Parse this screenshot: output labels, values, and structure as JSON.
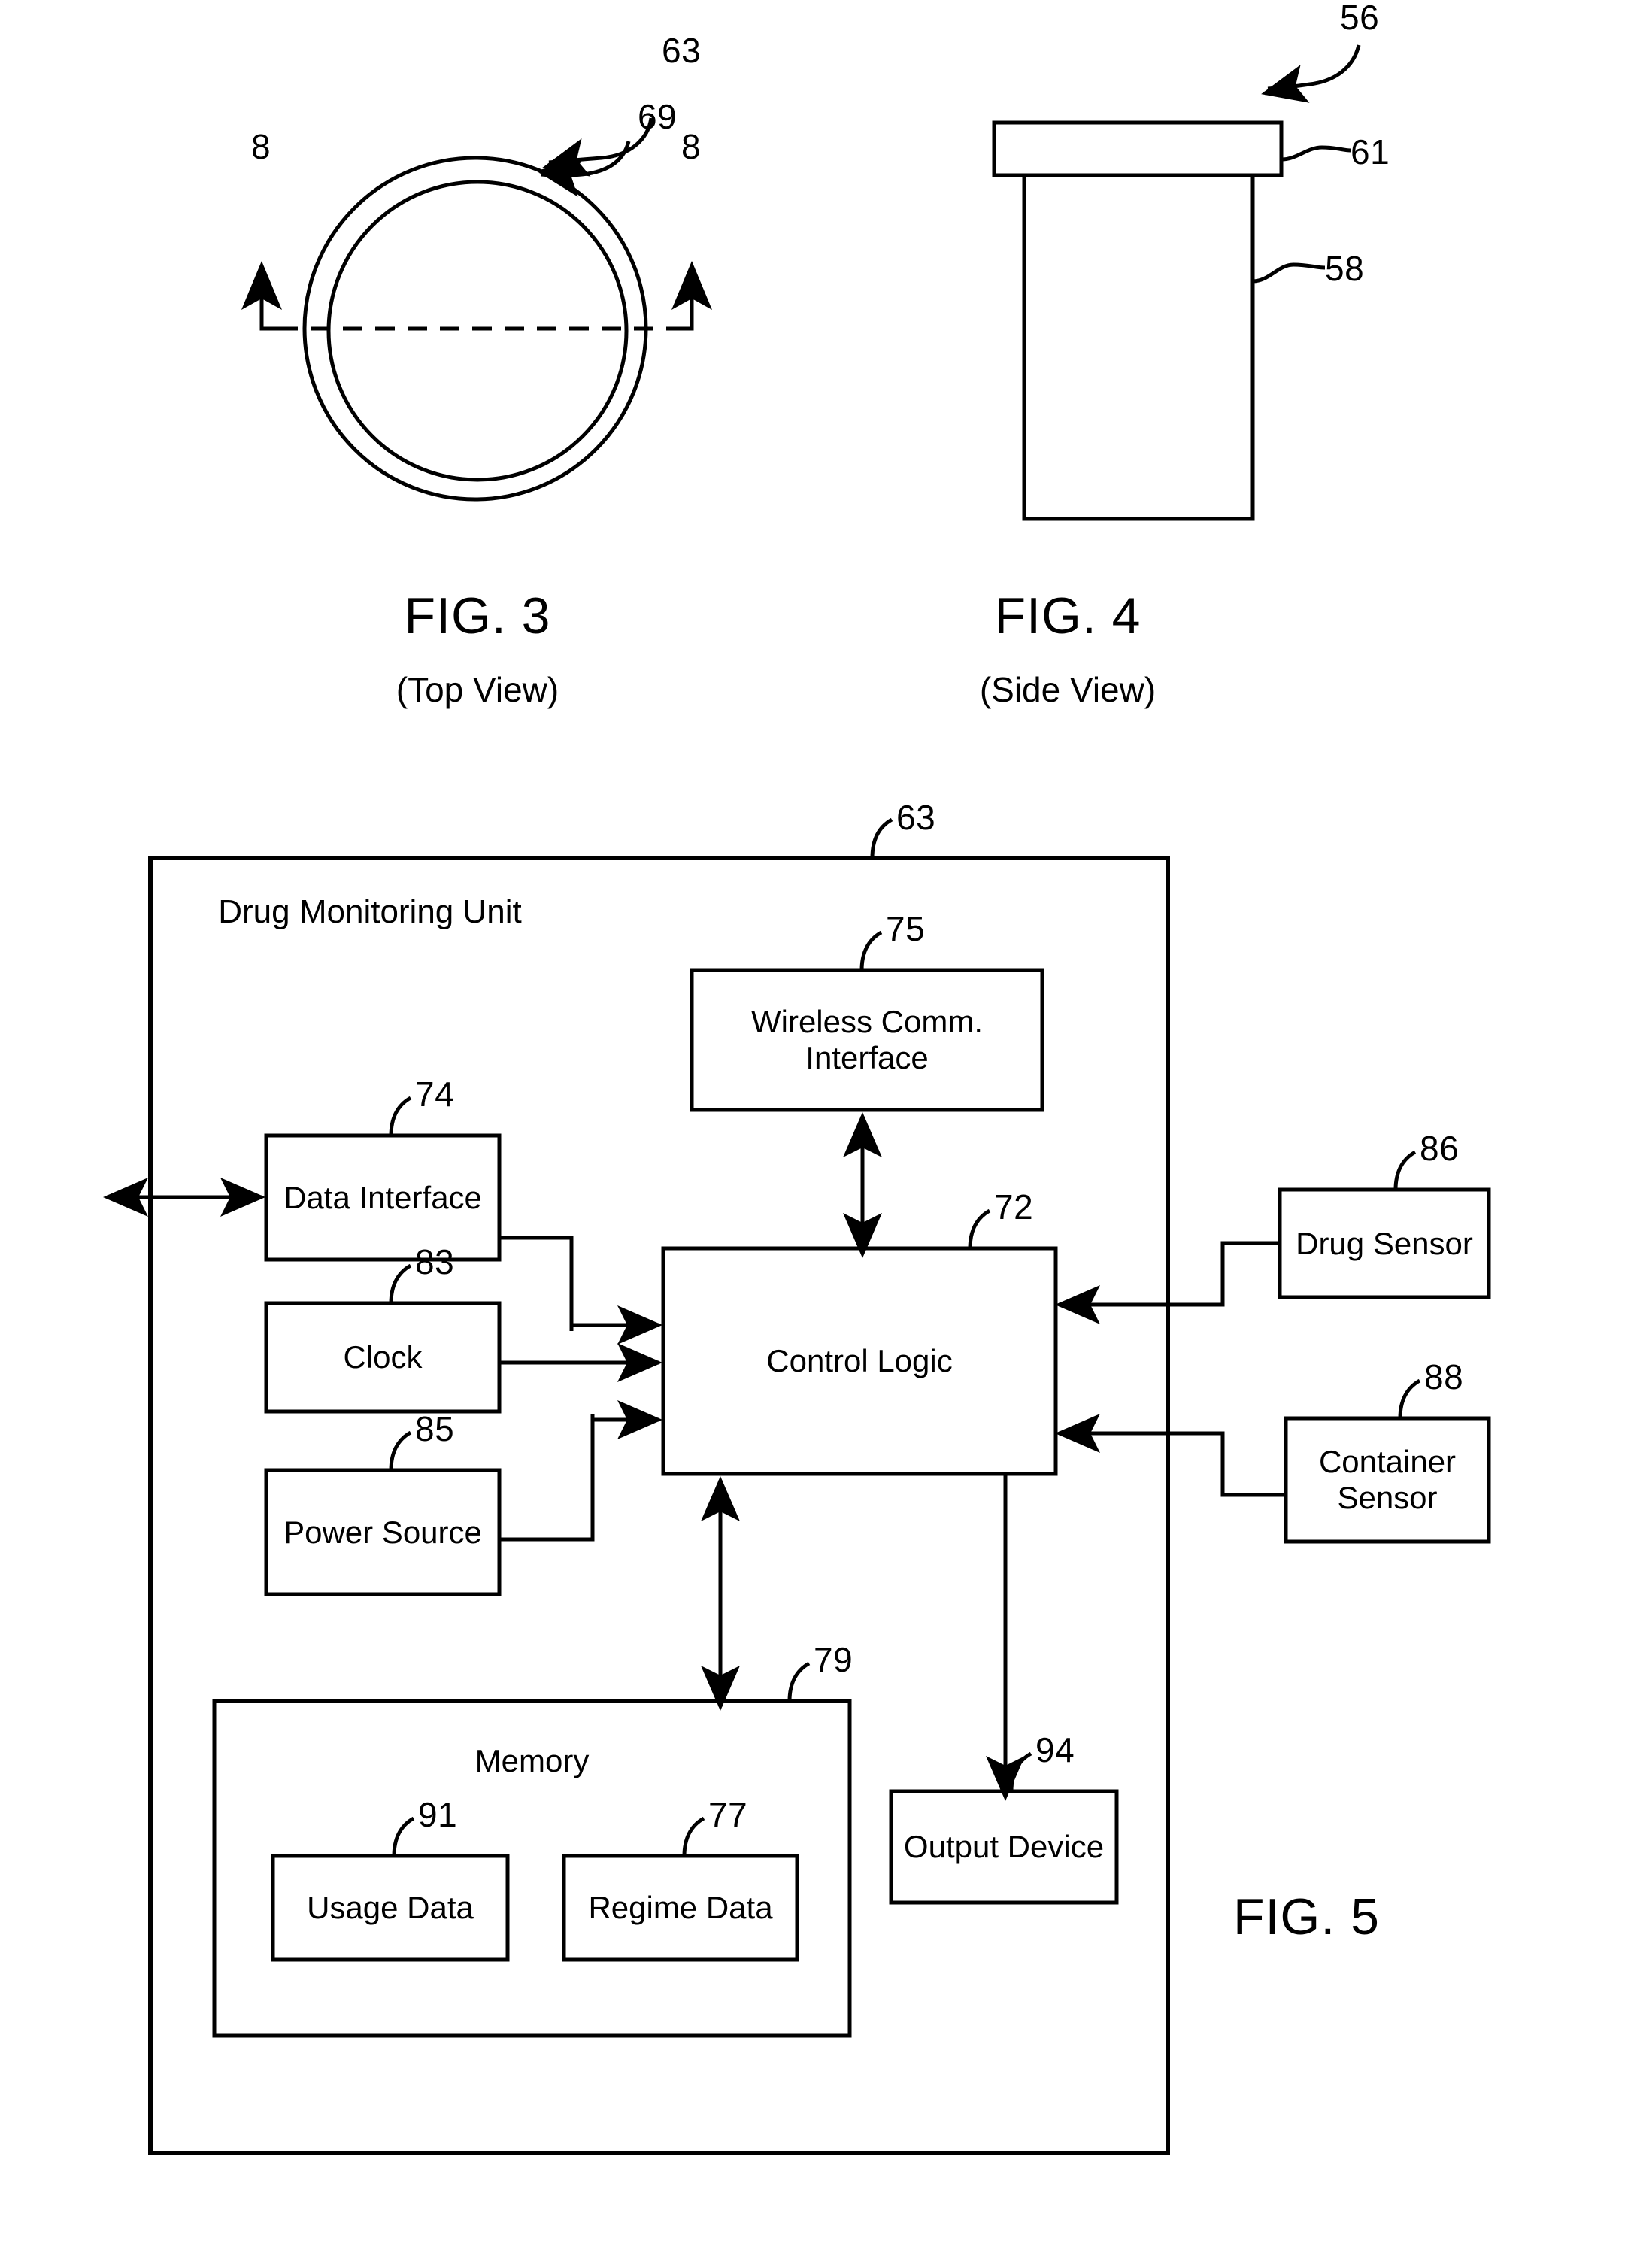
{
  "figures": [
    {
      "id": "fig3",
      "caption": "FIG. 3",
      "subcaption": "(Top View)",
      "refs": [
        {
          "id": "ref-63-fig3",
          "label": "63"
        },
        {
          "id": "ref-69-fig3",
          "label": "69"
        },
        {
          "id": "section-mark-left",
          "label": "8"
        },
        {
          "id": "section-mark-right",
          "label": "8"
        }
      ]
    },
    {
      "id": "fig4",
      "caption": "FIG. 4",
      "subcaption": "(Side View)",
      "refs": [
        {
          "id": "ref-56-fig4",
          "label": "56"
        },
        {
          "id": "ref-61-fig4",
          "label": "61"
        },
        {
          "id": "ref-58-fig4",
          "label": "58"
        }
      ]
    },
    {
      "id": "fig5",
      "caption": "FIG. 5",
      "subcaption": ""
    }
  ],
  "fig3": {
    "caption": "FIG. 3",
    "subcaption": "(Top View)",
    "ref_outer": "63",
    "ref_inner": "69",
    "section_left": "8",
    "section_right": "8"
  },
  "fig4": {
    "caption": "FIG. 4",
    "subcaption": "(Side View)",
    "ref_assembly": "56",
    "ref_cap": "61",
    "ref_body": "58"
  },
  "fig5": {
    "caption": "FIG. 5",
    "unit_title": "Drug Monitoring\nUnit",
    "ref_unit": "63",
    "blocks": [
      {
        "key": "wireless",
        "label": "Wireless Comm.\nInterface",
        "ref": "75"
      },
      {
        "key": "data_interface",
        "label": "Data\nInterface",
        "ref": "74"
      },
      {
        "key": "clock",
        "label": "Clock",
        "ref": "83"
      },
      {
        "key": "power_source",
        "label": "Power\nSource",
        "ref": "85"
      },
      {
        "key": "control_logic",
        "label": "Control\nLogic",
        "ref": "72"
      },
      {
        "key": "drug_sensor",
        "label": "Drug\nSensor",
        "ref": "86"
      },
      {
        "key": "container_sensor",
        "label": "Container\nSensor",
        "ref": "88"
      },
      {
        "key": "memory",
        "label": "Memory",
        "ref": "79"
      },
      {
        "key": "usage_data",
        "label": "Usage\nData",
        "ref": "91"
      },
      {
        "key": "regime_data",
        "label": "Regime\nData",
        "ref": "77"
      },
      {
        "key": "output_device",
        "label": "Output\nDevice",
        "ref": "94"
      }
    ],
    "labels": {
      "wireless": "Wireless Comm.\nInterface",
      "data_interface": "Data\nInterface",
      "clock": "Clock",
      "power_source": "Power\nSource",
      "control_logic": "Control\nLogic",
      "drug_sensor": "Drug\nSensor",
      "container_sensor": "Container\nSensor",
      "memory": "Memory",
      "usage_data": "Usage\nData",
      "regime_data": "Regime\nData",
      "output_device": "Output\nDevice"
    },
    "refs": {
      "unit": "63",
      "wireless": "75",
      "data_interface": "74",
      "clock": "83",
      "power_source": "85",
      "control_logic": "72",
      "drug_sensor": "86",
      "container_sensor": "88",
      "memory": "79",
      "usage_data": "91",
      "regime_data": "77",
      "output_device": "94"
    }
  },
  "colors": {
    "ink": "#000000",
    "paper": "#ffffff"
  }
}
